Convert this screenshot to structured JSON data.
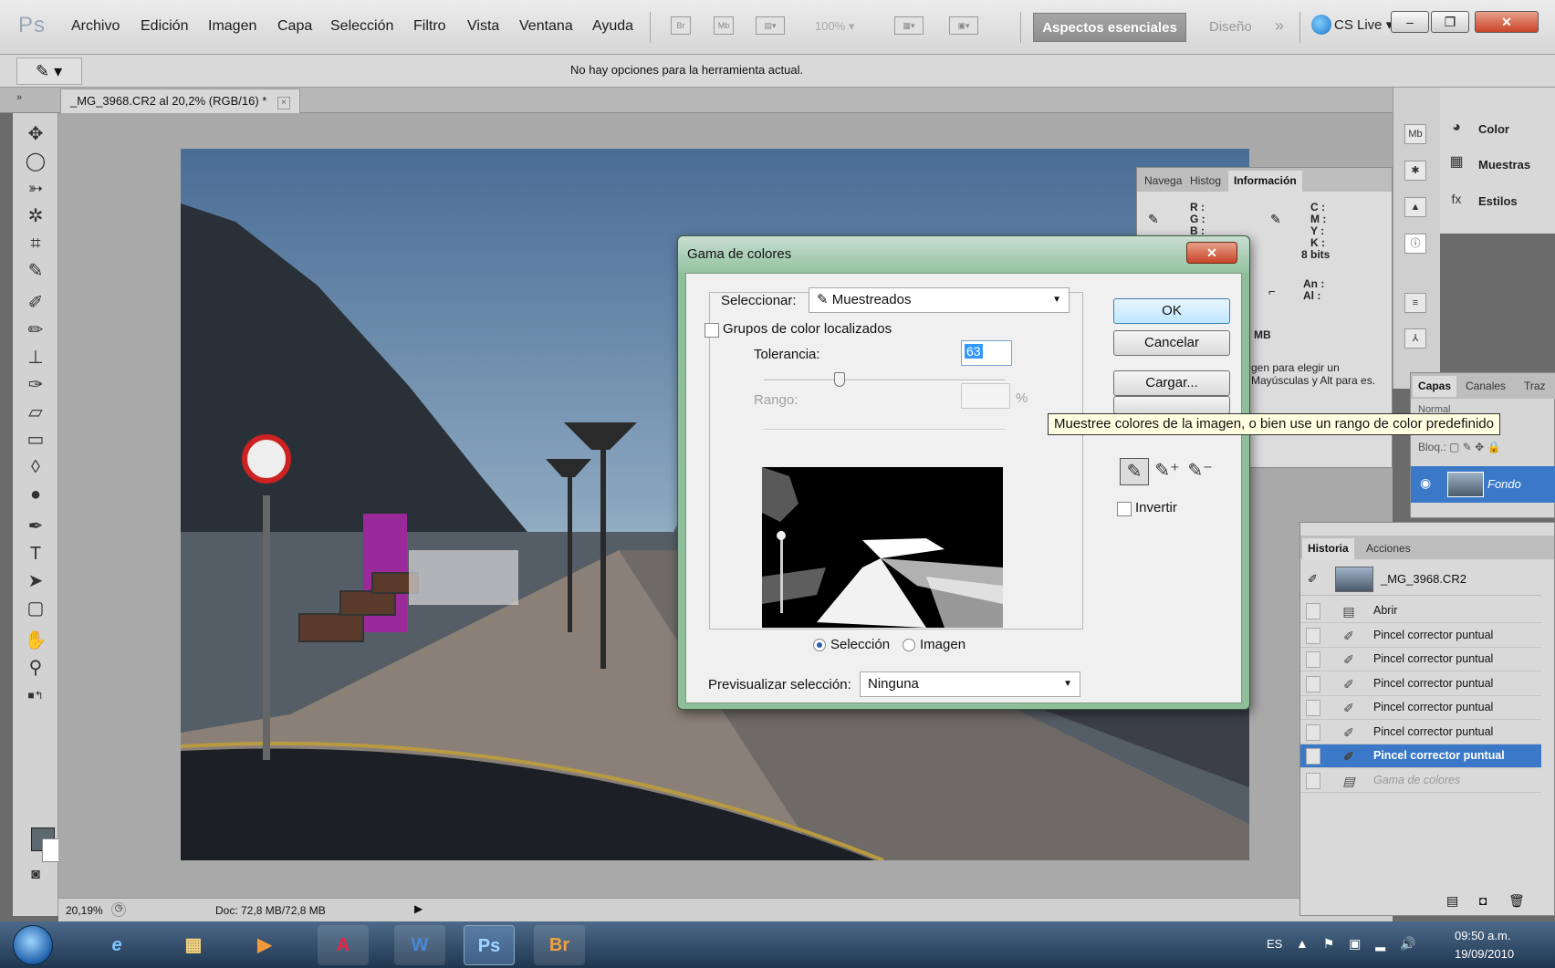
{
  "app": {
    "logo": "Ps",
    "menu": [
      "Archivo",
      "Edición",
      "Imagen",
      "Capa",
      "Selección",
      "Filtro",
      "Vista",
      "Ventana",
      "Ayuda"
    ],
    "zoom_combo": "100%",
    "workspace": "Aspectos esenciales",
    "design": "Diseño",
    "more": "»",
    "cslive": "CS Live",
    "window_buttons": {
      "minimize": "–",
      "restore": "❐",
      "close": "✕"
    }
  },
  "options_bar": {
    "message": "No hay opciones para la herramienta actual."
  },
  "document": {
    "tab_title": "_MG_3968.CR2 al 20,2% (RGB/16) *",
    "tab_close": "×",
    "zoom": "20,19%",
    "doc_info": "Doc: 72,8 MB/72,8 MB"
  },
  "dock": {
    "items": [
      {
        "label": "Color",
        "icon": "color-icon"
      },
      {
        "label": "Muestras",
        "icon": "swatches-icon"
      },
      {
        "label": "Estilos",
        "icon": "styles-icon"
      }
    ]
  },
  "info_panel": {
    "tabs": [
      "Navega",
      "Histog",
      "Información"
    ],
    "rgb": [
      "R :",
      "G :",
      "B :"
    ],
    "cmyk": [
      "C :",
      "M :",
      "Y :",
      "K :"
    ],
    "bits": "8 bits",
    "size": [
      "An :",
      "Al :"
    ],
    "mb": "MB",
    "hint": "gen para elegir un Mayúsculas y Alt para es."
  },
  "layers_panel": {
    "tabs": [
      "Capas",
      "Canales",
      "Traz"
    ],
    "blend": "Normal",
    "lock_label": "Bloq.:",
    "layer_name": "Fondo"
  },
  "history_panel": {
    "tabs": [
      "Historia",
      "Acciones"
    ],
    "snapshot": "_MG_3968.CR2",
    "steps": [
      {
        "label": "Abrir",
        "state": "normal"
      },
      {
        "label": "Pincel corrector puntual",
        "state": "normal"
      },
      {
        "label": "Pincel corrector puntual",
        "state": "normal"
      },
      {
        "label": "Pincel corrector puntual",
        "state": "normal"
      },
      {
        "label": "Pincel corrector puntual",
        "state": "normal"
      },
      {
        "label": "Pincel corrector puntual",
        "state": "normal"
      },
      {
        "label": "Pincel corrector puntual",
        "state": "selected"
      },
      {
        "label": "Gama de colores",
        "state": "dim"
      }
    ]
  },
  "dialog": {
    "title": "Gama de colores",
    "close": "✕",
    "select_label": "Seleccionar:",
    "select_value": "Muestreados",
    "localized_label": "Grupos de color localizados",
    "localized_checked": false,
    "tolerance_label": "Tolerancia:",
    "tolerance_value": "63",
    "tolerance_level": 0.315,
    "range_label": "Rango:",
    "range_unit": "%",
    "view_selection": "Selección",
    "view_image": "Imagen",
    "view_selected": "selection",
    "preview_label": "Previsualizar selección:",
    "preview_value": "Ninguna",
    "buttons": {
      "ok": "OK",
      "cancel": "Cancelar",
      "load": "Cargar..."
    },
    "invert_label": "Invertir",
    "invert_checked": false
  },
  "tooltip": "Muestree colores de la imagen, o bien use un rango de color predefinido",
  "taskbar": {
    "apps": [
      {
        "name": "ie",
        "label": "e"
      },
      {
        "name": "explorer",
        "label": "▦"
      },
      {
        "name": "media",
        "label": "▶"
      },
      {
        "name": "acrobat",
        "label": "A"
      },
      {
        "name": "word",
        "label": "W"
      },
      {
        "name": "photoshop",
        "label": "Ps"
      },
      {
        "name": "bridge",
        "label": "Br"
      }
    ],
    "lang": "ES",
    "time": "09:50 a.m.",
    "date": "19/09/2010"
  }
}
